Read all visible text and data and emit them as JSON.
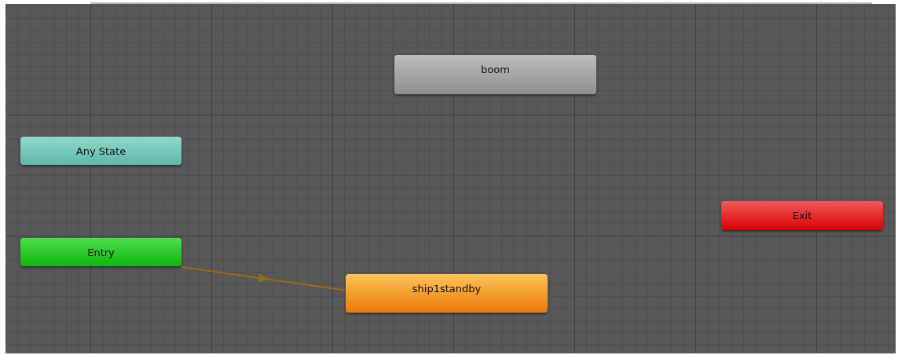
{
  "states": [
    {
      "label": "boom",
      "kind": "state"
    },
    {
      "label": "Any State",
      "kind": "any"
    },
    {
      "label": "Entry",
      "kind": "entry"
    },
    {
      "label": "ship1standby",
      "kind": "default"
    },
    {
      "label": "Exit",
      "kind": "exit"
    }
  ]
}
